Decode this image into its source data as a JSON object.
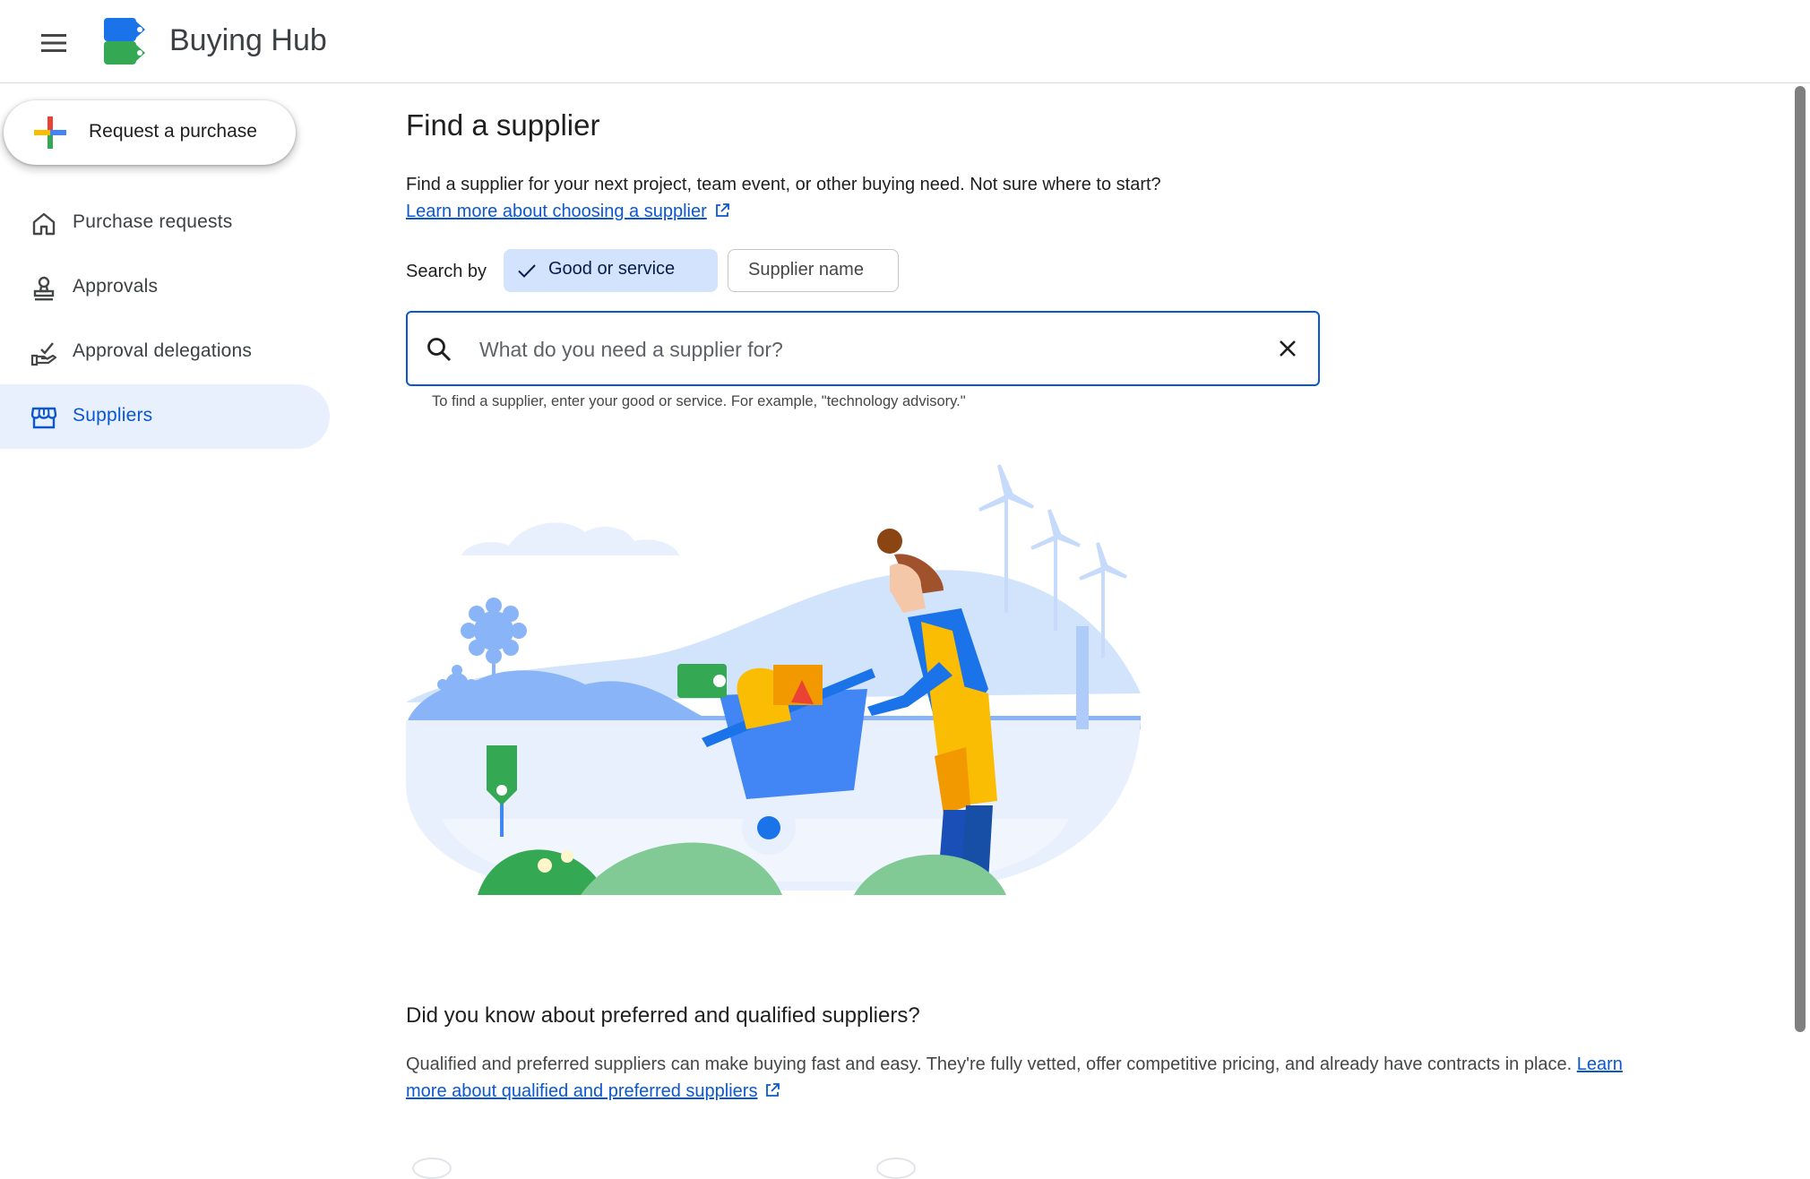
{
  "app": {
    "title": "Buying Hub",
    "menu_icon": "hamburger-menu-icon",
    "logo_icon": "buying-hub-logo"
  },
  "sidebar": {
    "fab_label": "Request a purchase",
    "items": [
      {
        "label": "Purchase requests",
        "icon": "home-icon",
        "active": false
      },
      {
        "label": "Approvals",
        "icon": "stamp-icon",
        "active": false
      },
      {
        "label": "Approval delegations",
        "icon": "hand-check-icon",
        "active": false
      },
      {
        "label": "Suppliers",
        "icon": "storefront-icon",
        "active": true
      }
    ]
  },
  "main": {
    "title": "Find a supplier",
    "intro": "Find a supplier for your next project, team event, or other buying need. Not sure where to start?",
    "intro_link": "Learn more about choosing a supplier",
    "search_by_label": "Search by",
    "chips": [
      {
        "label": "Good or service",
        "selected": true
      },
      {
        "label": "Supplier name",
        "selected": false
      }
    ],
    "search": {
      "placeholder": "What do you need a supplier for?",
      "value": ""
    },
    "helper": "To find a supplier, enter your good or service. For example, \"technology advisory.\"",
    "did_you_know": {
      "title": "Did you know about preferred and qualified suppliers?",
      "text": "Qualified and preferred suppliers can make buying fast and easy. They're fully vetted, offer competitive pricing, and already have contracts in place.",
      "link": "Learn more about qualified and preferred suppliers"
    }
  },
  "colors": {
    "accent": "#0b57d0",
    "active_nav_bg": "#e8f0fe",
    "chip_selected_bg": "#d3e3fd"
  }
}
